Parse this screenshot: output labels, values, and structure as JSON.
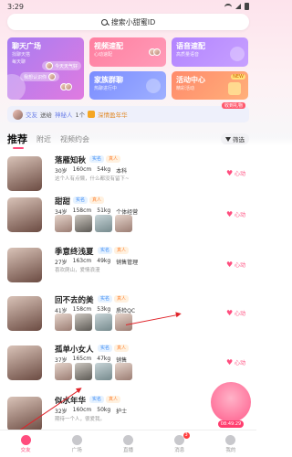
{
  "status_bar": {
    "time": "3:29"
  },
  "search": {
    "placeholder": "搜索小甜蜜ID"
  },
  "cards": {
    "chat": {
      "title": "聊天广场",
      "sub1": "找聊天搭",
      "sub2": "每天聊",
      "pill1": "今天天气好",
      "pill2": "我想认识你"
    },
    "video": {
      "title": "视频速配",
      "sub": "心动速配"
    },
    "voice": {
      "title": "语音速配",
      "sub": "高质量语音"
    },
    "family": {
      "title": "家族群聊",
      "sub": "热聊进行中"
    },
    "activity": {
      "title": "活动中心",
      "sub": "精彩活动",
      "badge": "NEW"
    }
  },
  "notice": {
    "user": "交友",
    "action1": "送给",
    "target": "神秘人",
    "count": "1个",
    "gift": "深情盈年华",
    "tag": "收到礼物"
  },
  "tabs": [
    {
      "label": "推荐"
    },
    {
      "label": "附近"
    },
    {
      "label": "视频约会"
    }
  ],
  "filter": {
    "label": "筛选"
  },
  "users": [
    {
      "name": "落雁知秋",
      "meta": [
        "30岁",
        "160cm",
        "54kg",
        "本科"
      ],
      "bio": "这个人有点懒，什么都没有留下~",
      "real": "实名",
      "real2": "真人",
      "like": "心动",
      "photos": 0
    },
    {
      "name": "甜甜",
      "meta": [
        "34岁",
        "158cm",
        "51kg",
        "个体经营"
      ],
      "bio": "",
      "real": "实名",
      "real2": "真人",
      "like": "心动",
      "photos": 4
    },
    {
      "name": "季意终浅夏",
      "meta": [
        "27岁",
        "163cm",
        "49kg",
        "销售管理"
      ],
      "bio": "喜欢爬山，爱情浪漫",
      "real": "实名",
      "real2": "真人",
      "like": "心动",
      "photos": 0
    },
    {
      "name": "回不去的美",
      "meta": [
        "41岁",
        "158cm",
        "53kg",
        "质检QC"
      ],
      "bio": "",
      "real": "实名",
      "real2": "真人",
      "like": "心动",
      "photos": 4
    },
    {
      "name": "孤单小女人",
      "meta": [
        "37岁",
        "165cm",
        "47kg",
        "销售"
      ],
      "bio": "",
      "real": "实名",
      "real2": "真人",
      "like": "心动",
      "photos": 4
    },
    {
      "name": "似水年华",
      "meta": [
        "32岁",
        "160cm",
        "50kg",
        "护士"
      ],
      "bio": "期待一个人，很爱我。",
      "real": "实名",
      "real2": "真人",
      "like": "心动",
      "photos": 0
    }
  ],
  "promo": {
    "timer": "08:49:29"
  },
  "nav": [
    {
      "label": "交友",
      "badge": ""
    },
    {
      "label": "广场",
      "badge": ""
    },
    {
      "label": "直播",
      "badge": ""
    },
    {
      "label": "消息",
      "badge": "3"
    },
    {
      "label": "我的",
      "badge": ""
    }
  ]
}
